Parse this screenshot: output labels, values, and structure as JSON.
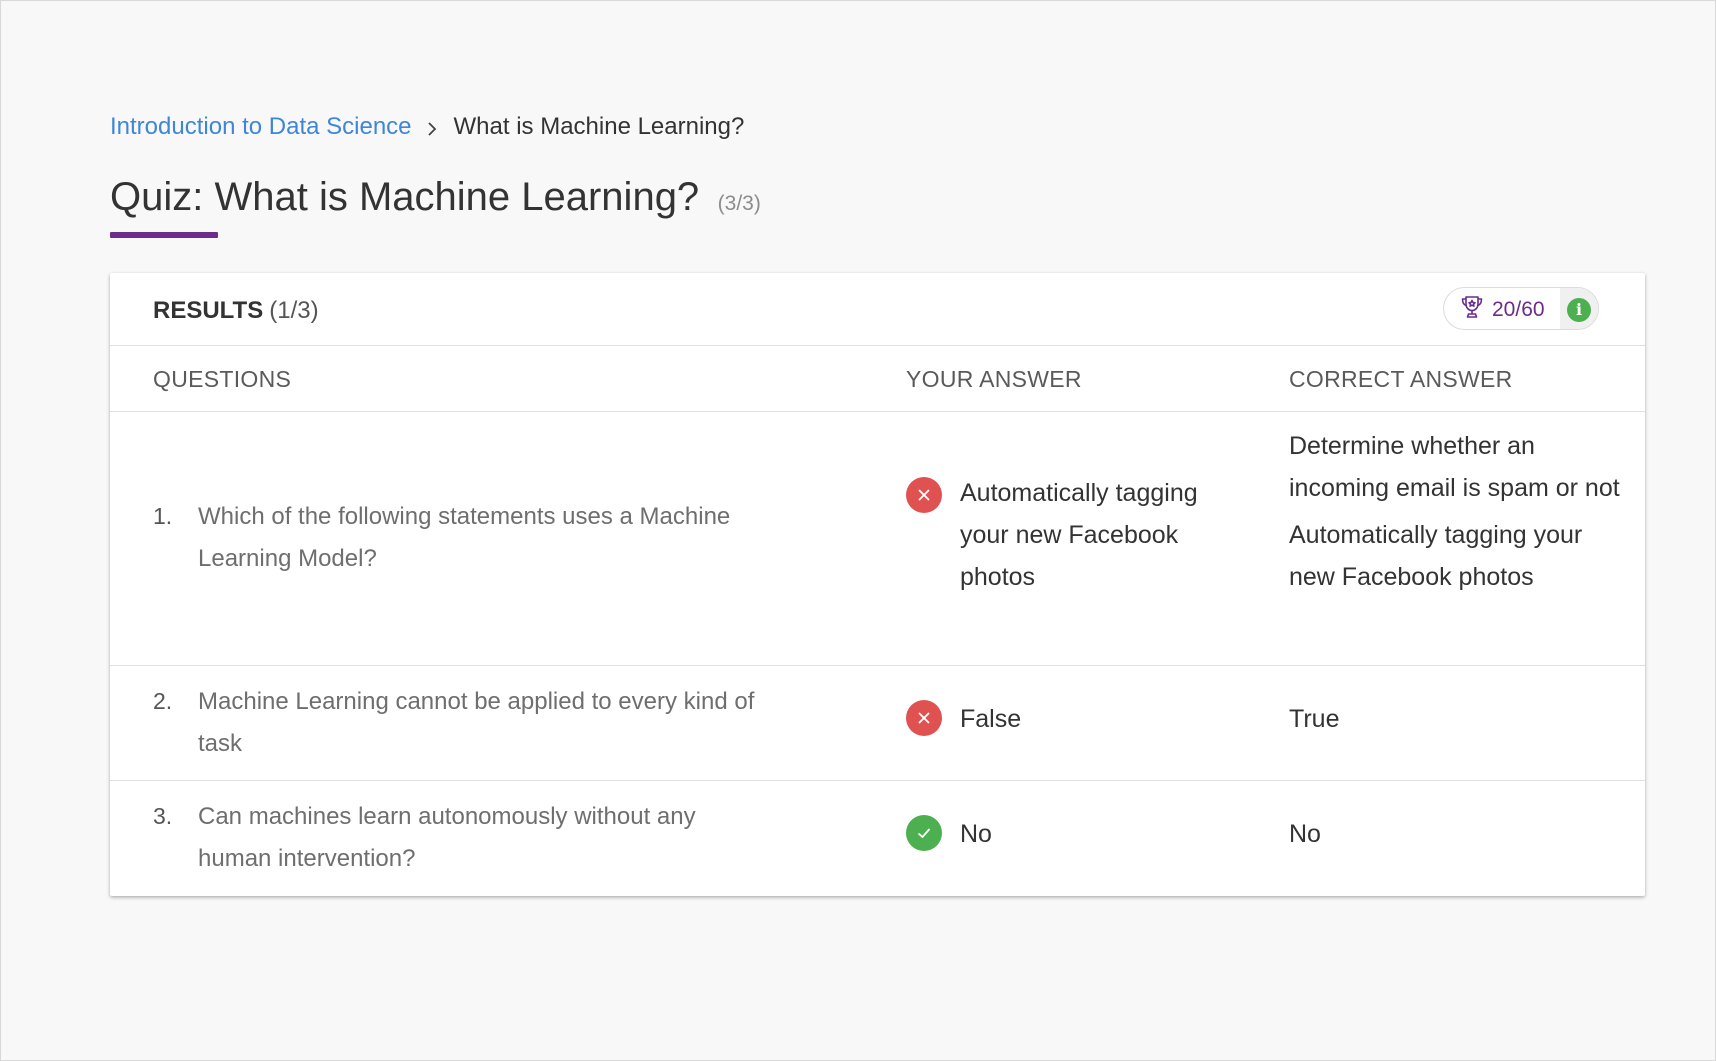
{
  "breadcrumb": {
    "parent": "Introduction to Data Science",
    "separator_icon": "chevron-right-icon",
    "current": "What is Machine Learning?"
  },
  "page": {
    "title": "Quiz: What is Machine Learning?",
    "progress": "(3/3)",
    "accent_color": "#6b2c8b"
  },
  "results": {
    "label": "RESULTS",
    "count": "(1/3)",
    "score": "20/60",
    "score_icon": "trophy-icon",
    "info_icon": "info-icon",
    "info_glyph": "i"
  },
  "columns": {
    "questions": "QUESTIONS",
    "your_answer": "YOUR ANSWER",
    "correct_answer": "CORRECT ANSWER"
  },
  "rows": [
    {
      "number": "1.",
      "question": "Which of the following statements uses a Machine Learning Model?",
      "status": "incorrect",
      "your_answer": "Automatically tagging your new Facebook photos",
      "correct_answers": [
        "Determine whether an incoming email is spam or not",
        "Automatically tagging your new Facebook photos"
      ]
    },
    {
      "number": "2.",
      "question": "Machine Learning cannot be applied to every kind of task",
      "status": "incorrect",
      "your_answer": "False",
      "correct_answers": [
        "True"
      ]
    },
    {
      "number": "3.",
      "question": "Can machines learn autonomously without any human intervention?",
      "status": "correct",
      "your_answer": "No",
      "correct_answers": [
        "No"
      ]
    }
  ],
  "colors": {
    "link": "#3f86d6",
    "incorrect": "#e05252",
    "correct": "#4caf50"
  }
}
